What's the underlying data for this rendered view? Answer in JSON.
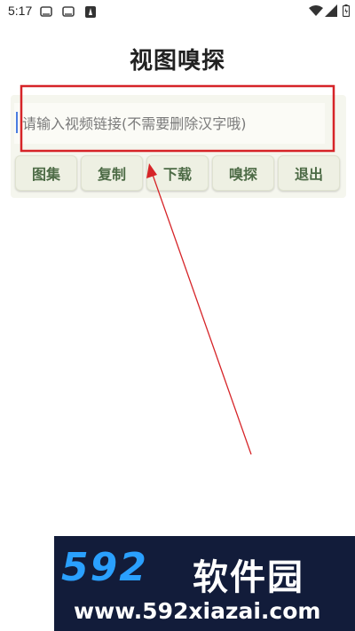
{
  "status_bar": {
    "time": "5:17"
  },
  "title": "视图嗅探",
  "input": {
    "value": "",
    "placeholder": "请输入视频链接(不需要删除汉字哦)"
  },
  "buttons": [
    {
      "label": "图集"
    },
    {
      "label": "复制"
    },
    {
      "label": "下载"
    },
    {
      "label": "嗅探"
    },
    {
      "label": "退出"
    }
  ],
  "annotation": {
    "highlight_color": "#d62428",
    "arrow_color": "#d62428"
  },
  "watermark": {
    "number": "592",
    "name": "软件园",
    "url": "www.592xiazai.com"
  }
}
